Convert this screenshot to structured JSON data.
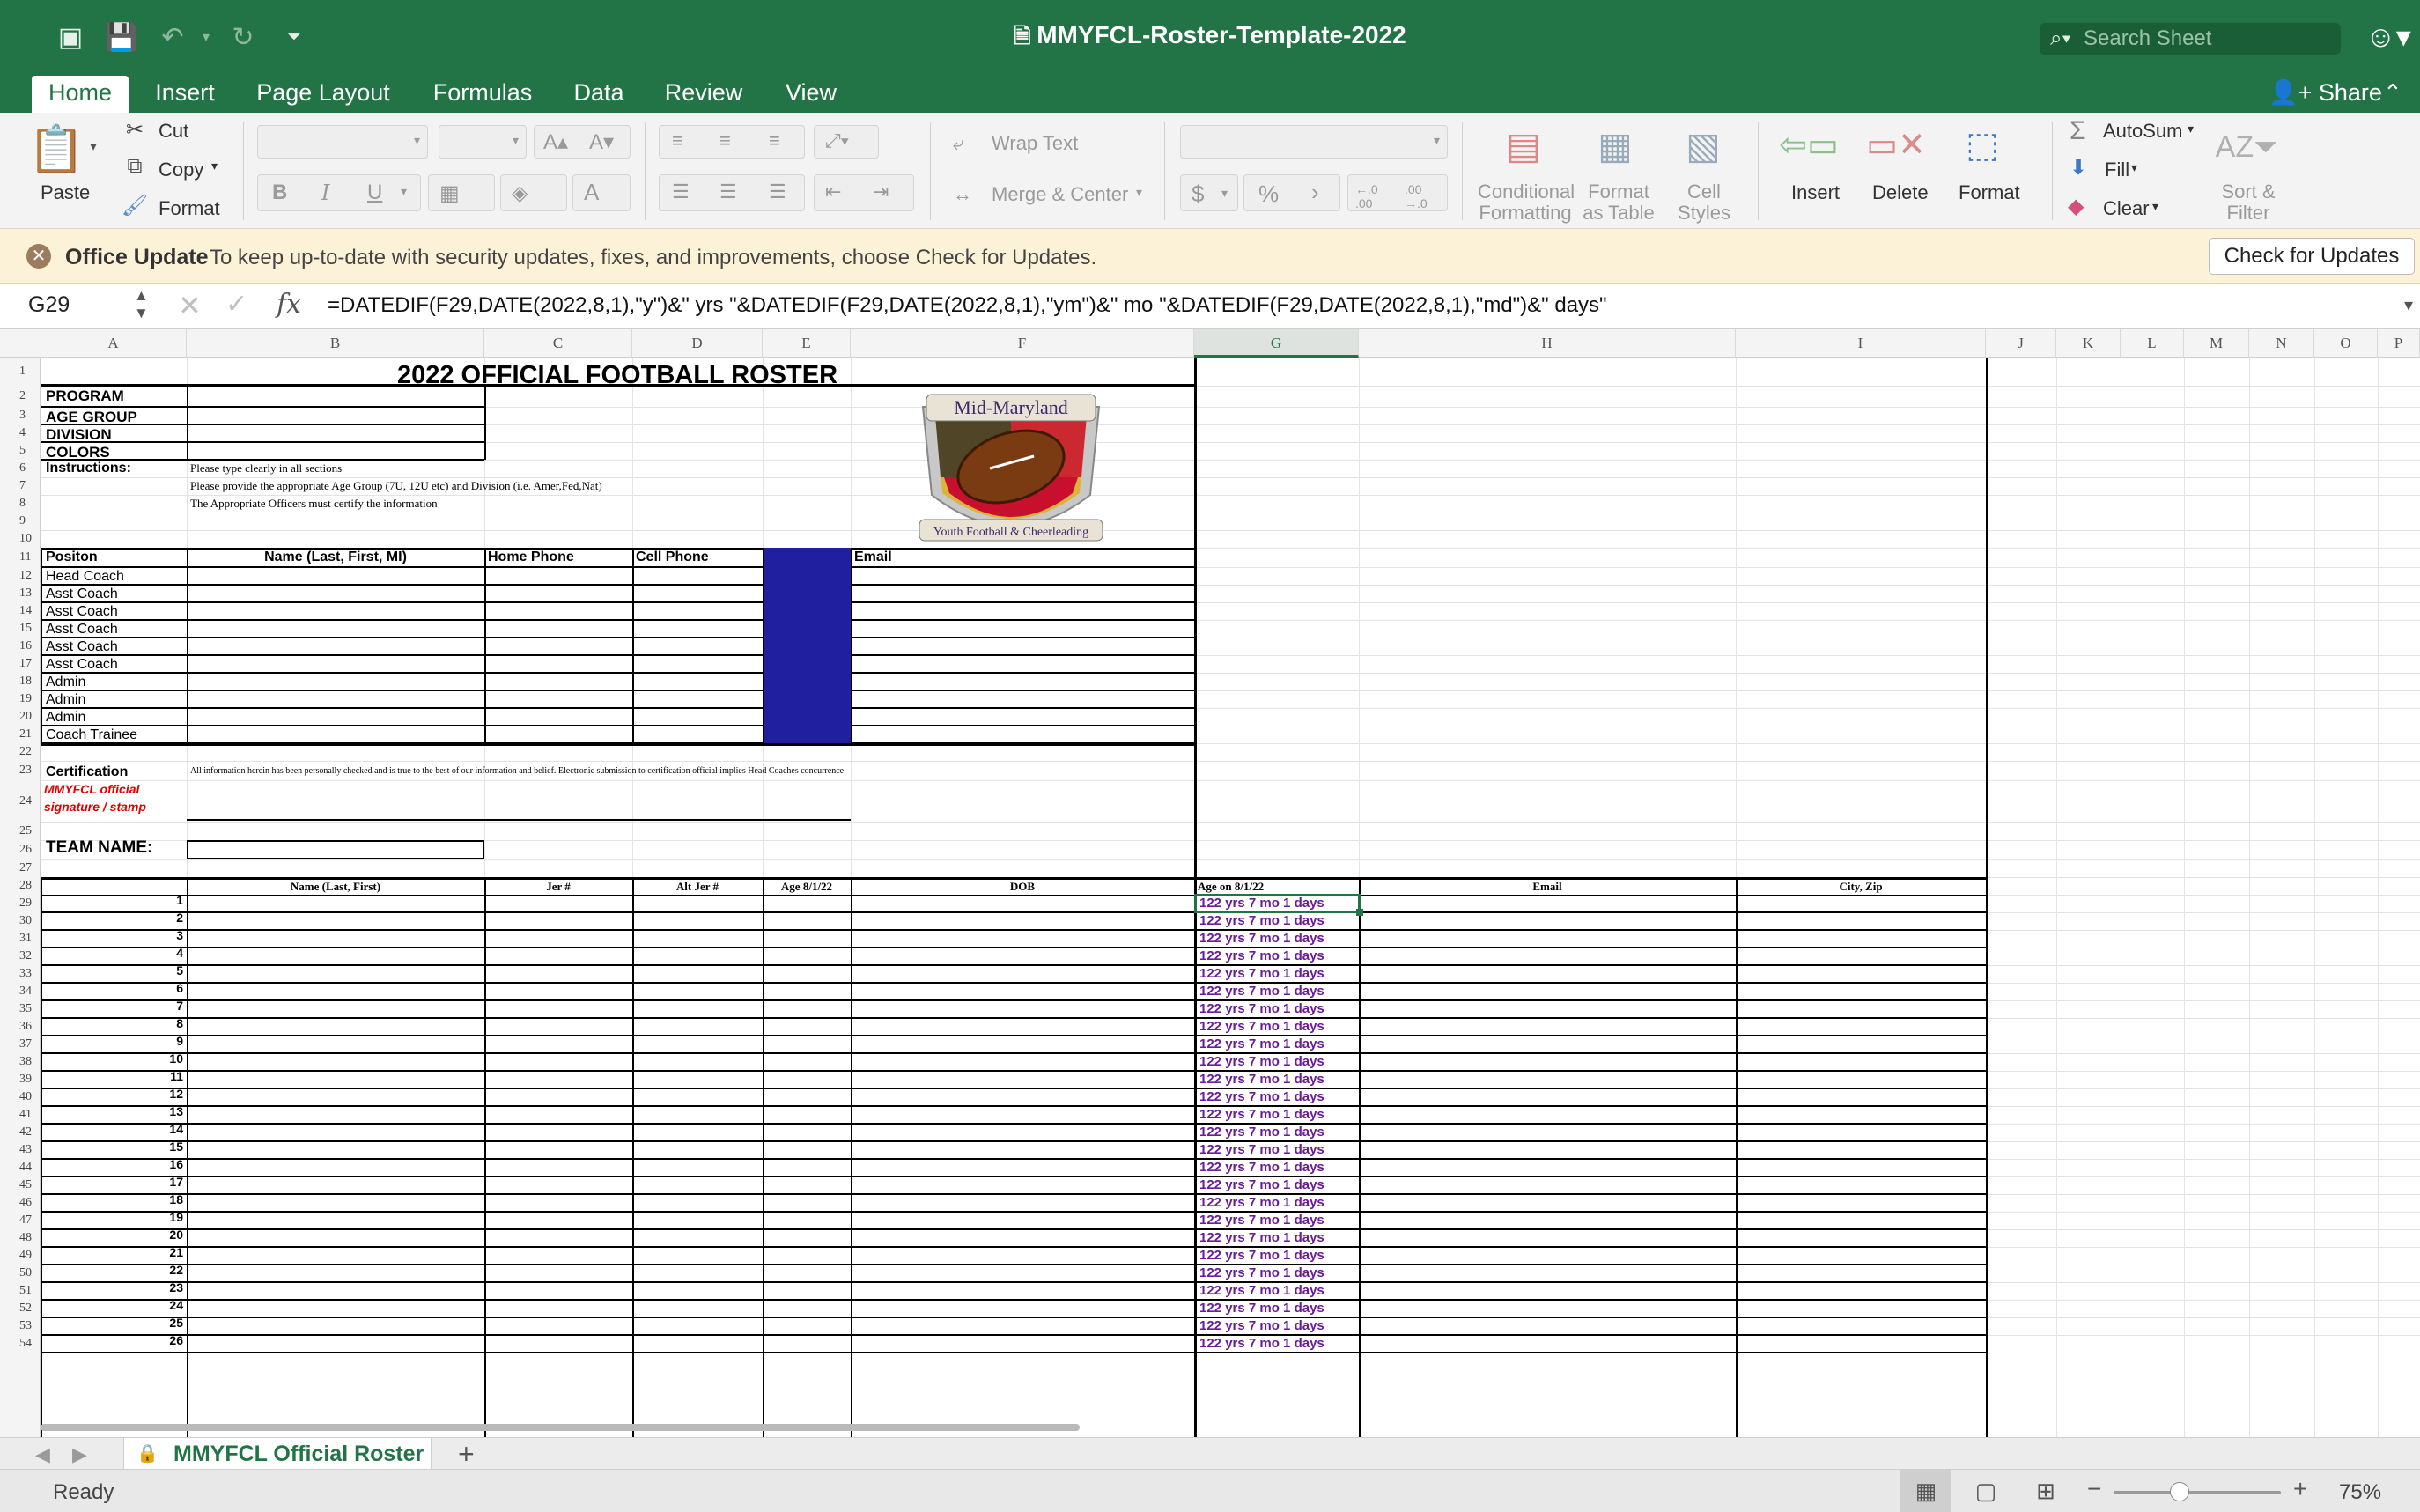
{
  "window": {
    "title": "MMYFCL-Roster-Template-2022"
  },
  "search": {
    "placeholder": "Search Sheet"
  },
  "tabs": [
    "Home",
    "Insert",
    "Page Layout",
    "Formulas",
    "Data",
    "Review",
    "View"
  ],
  "share_label": "Share",
  "ribbon": {
    "paste": "Paste",
    "cut": "Cut",
    "copy": "Copy",
    "format_painter": "Format",
    "wrap_text": "Wrap Text",
    "merge_center": "Merge & Center",
    "number_currency": "$",
    "number_percent": "%",
    "conditional_formatting": [
      "Conditional",
      "Formatting"
    ],
    "format_as_table": [
      "Format",
      "as Table"
    ],
    "cell_styles": [
      "Cell",
      "Styles"
    ],
    "insert": "Insert",
    "delete": "Delete",
    "format": "Format",
    "autosum": "AutoSum",
    "fill": "Fill",
    "clear": "Clear",
    "sort_filter": [
      "Sort &",
      "Filter"
    ]
  },
  "message_bar": {
    "title": "Office Update",
    "text": "To keep up-to-date with security updates, fixes, and improvements, choose Check for Updates.",
    "button": "Check for Updates"
  },
  "formula_bar": {
    "name_box": "G29",
    "fx": "fx",
    "formula": "=DATEDIF(F29,DATE(2022,8,1),\"y\")&\" yrs \"&DATEDIF(F29,DATE(2022,8,1),\"ym\")&\" mo \"&DATEDIF(F29,DATE(2022,8,1),\"md\")&\" days\""
  },
  "columns": [
    "A",
    "B",
    "C",
    "D",
    "E",
    "F",
    "G",
    "H",
    "I",
    "J",
    "K",
    "L",
    "M",
    "N",
    "O",
    "P"
  ],
  "selected_column": "G",
  "rows": [
    "1",
    "2",
    "3",
    "4",
    "5",
    "6",
    "7",
    "8",
    "9",
    "10",
    "11",
    "12",
    "13",
    "14",
    "15",
    "16",
    "17",
    "18",
    "19",
    "20",
    "21",
    "22",
    "23",
    "24",
    "25",
    "26",
    "27",
    "28",
    "29",
    "30",
    "31",
    "32",
    "33",
    "34",
    "35",
    "36",
    "37",
    "38",
    "39",
    "40",
    "41",
    "42",
    "43",
    "44",
    "45",
    "46",
    "47",
    "48",
    "49",
    "50",
    "51",
    "52",
    "53",
    "54"
  ],
  "sheet": {
    "title": "2022 OFFICIAL FOOTBALL ROSTER",
    "program_label": "PROGRAM",
    "age_group_label": "AGE GROUP",
    "division_label": "DIVISION",
    "colors_label": "COLORS",
    "instructions_label": "Instructions:",
    "instructions": [
      "Please type clearly in all sections",
      "Please provide the appropriate Age Group (7U, 12U etc) and Division (i.e. Amer,Fed,Nat)",
      "The Appropriate Officers must certify the information"
    ],
    "logo": {
      "top_text": "Mid-Maryland",
      "bottom_text": "Youth Football & Cheerleading"
    },
    "staff_headers": [
      "Positon",
      "Name (Last, First, MI)",
      "Home Phone",
      "Cell Phone",
      "Email"
    ],
    "staff_positions": [
      "Head Coach",
      "Asst Coach",
      "Asst Coach",
      "Asst Coach",
      "Asst Coach",
      "Asst Coach",
      "Admin",
      "Admin",
      "Admin",
      "Coach Trainee"
    ],
    "certification_label": "Certification",
    "certification_text": "All information herein has been personally checked and is true to the best of our information and belief.  Electronic submission to certification official implies Head Coaches concurrence",
    "signature_label": [
      "MMYFCL official",
      "signature / stamp"
    ],
    "team_name_label": "TEAM NAME:",
    "roster_headers": [
      "Name (Last, First)",
      "Jer #",
      "Alt Jer #",
      "Age 8/1/22",
      "DOB",
      "Age on 8/1/22",
      "Email",
      "City, Zip"
    ],
    "player_numbers": [
      "1",
      "2",
      "3",
      "4",
      "5",
      "6",
      "7",
      "8",
      "9",
      "10",
      "11",
      "12",
      "13",
      "14",
      "15",
      "16",
      "17",
      "18",
      "19",
      "20",
      "21",
      "22",
      "23",
      "24",
      "25",
      "26"
    ],
    "age_value": "122 yrs 7 mo 1 days"
  },
  "sheet_tab": "MMYFCL Official Roster",
  "status": "Ready",
  "zoom": "75%",
  "colors": {
    "accent": "#227446",
    "staff_fill": "#1f1fa0",
    "signature": "#e00000",
    "age_text": "#6a1b9a"
  }
}
